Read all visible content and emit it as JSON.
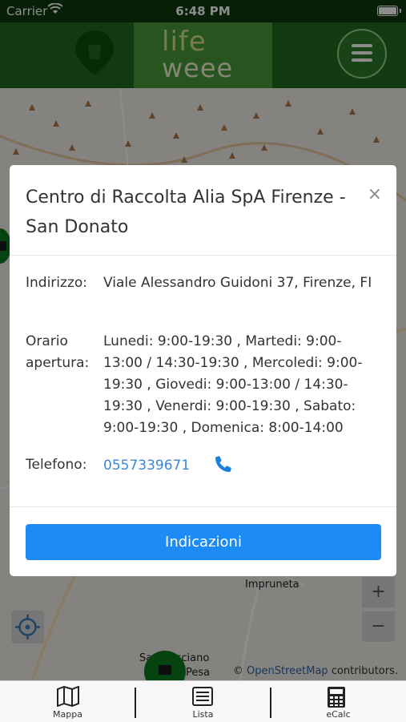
{
  "status_bar": {
    "carrier": "Carrier",
    "time": "6:48 PM"
  },
  "header": {
    "logo_top": "life",
    "logo_bottom": "weee",
    "menu_icon": "hamburger-icon"
  },
  "modal": {
    "title": "Centro di Raccolta Alia SpA Firenze - San Donato",
    "close": "×",
    "address_label": "Indirizzo:",
    "address_value": "Viale Alessandro Guidoni 37, Firenze, FI",
    "hours_label": "Orario apertura:",
    "hours_value": "Lunedi: 9:00-19:30 , Martedi: 9:00-13:00 / 14:30-19:30 , Mercoledi: 9:00-19:30 , Giovedi: 9:00-13:00 / 14:30-19:30 , Venerdi: 9:00-19:30 , Sabato: 9:00-19:30 , Domenica: 8:00-14:00",
    "phone_label": "Telefono:",
    "phone_value": "0557339671",
    "directions_button": "Indicazioni"
  },
  "map": {
    "zoom_in": "+",
    "zoom_out": "−",
    "place_impruneta": "Impruneta",
    "place_casciano": "San Casciano",
    "place_pesa": "Pesa",
    "attribution_prefix": "©",
    "attribution_link": "OpenStreetMap",
    "attribution_suffix": "contributors."
  },
  "tabs": [
    {
      "label": "Mappa",
      "icon": "map-icon"
    },
    {
      "label": "Lista",
      "icon": "list-icon"
    },
    {
      "label": "eCalc",
      "icon": "calculator-icon"
    }
  ],
  "colors": {
    "header": "#1f6b1f",
    "button": "#1d8bf5",
    "link": "#3a87d8"
  }
}
